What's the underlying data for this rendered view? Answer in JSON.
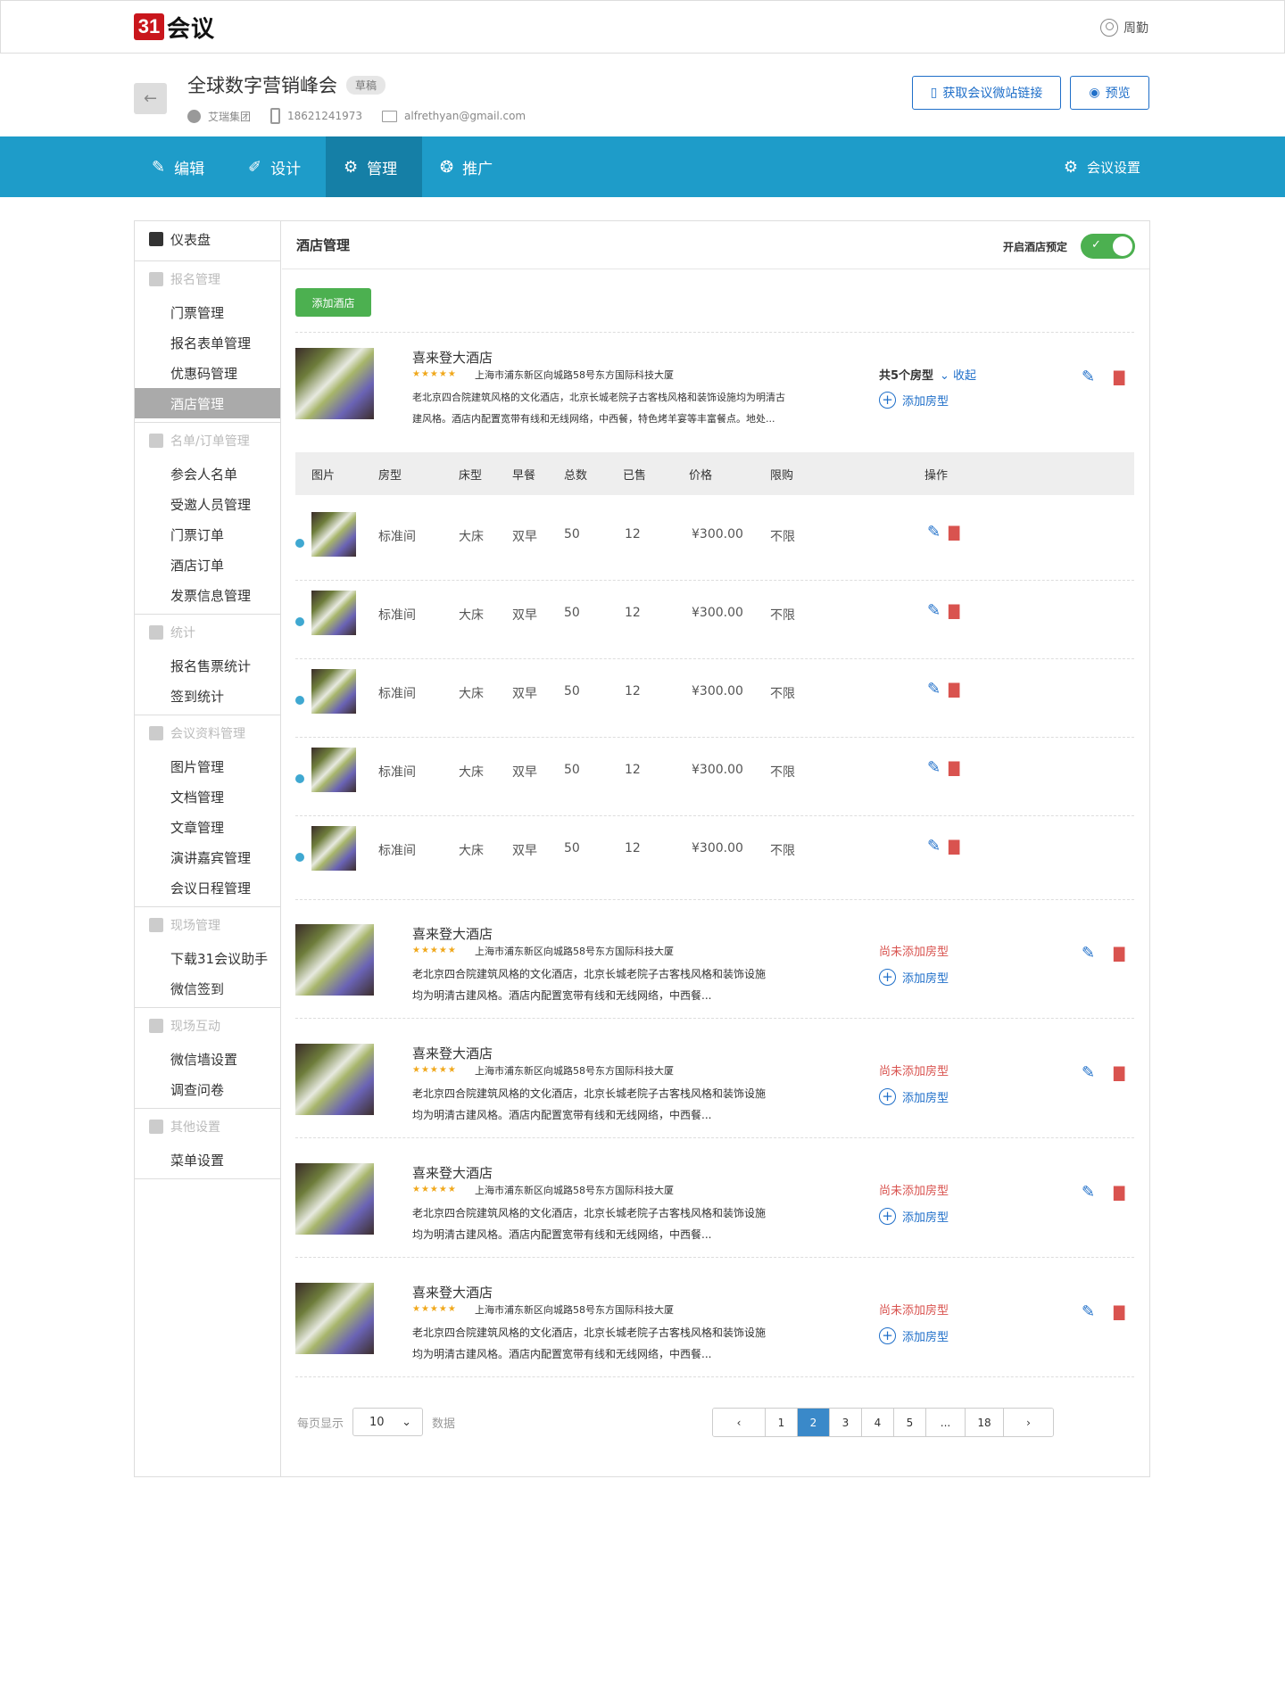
{
  "topbar": {
    "logo_mark": "31",
    "logo_text": "会议",
    "user_name": "周勤"
  },
  "event": {
    "back_icon": "←",
    "title": "全球数字营销峰会",
    "status": "草稿",
    "org": "艾瑞集团",
    "phone": "18621241973",
    "email": "alfrethyan@gmail.com",
    "btn_link": "获取会议微站链接",
    "btn_preview": "预览"
  },
  "nav": {
    "items": [
      {
        "label": "编辑",
        "icon": "✎"
      },
      {
        "label": "设计",
        "icon": "✐"
      },
      {
        "label": "管理",
        "icon": "⚙"
      },
      {
        "label": "推广",
        "icon": "❂"
      }
    ],
    "settings": "会议设置",
    "settings_icon": "⚙"
  },
  "sidebar": {
    "dashboard": "仪表盘",
    "groups": [
      {
        "title": "报名管理",
        "items": [
          "门票管理",
          "报名表单管理",
          "优惠码管理",
          "酒店管理"
        ]
      },
      {
        "title": "名单/订单管理",
        "items": [
          "参会人名单",
          "受邀人员管理",
          "门票订单",
          "酒店订单",
          "发票信息管理"
        ]
      },
      {
        "title": "统计",
        "items": [
          "报名售票统计",
          "签到统计"
        ]
      },
      {
        "title": "会议资料管理",
        "items": [
          "图片管理",
          "文档管理",
          "文章管理",
          "演讲嘉宾管理",
          "会议日程管理"
        ]
      },
      {
        "title": "现场管理",
        "items": [
          "下载31会议助手",
          "微信签到"
        ]
      },
      {
        "title": "现场互动",
        "items": [
          "微信墙设置",
          "调查问卷"
        ]
      },
      {
        "title": "其他设置",
        "items": [
          "菜单设置"
        ]
      }
    ]
  },
  "main": {
    "title": "酒店管理",
    "toggle_label": "开启酒店预定",
    "toggle_on": true,
    "add_hotel": "添加酒店",
    "hotel": {
      "name": "喜来登大酒店",
      "stars": "★★★★★",
      "address": "上海市浦东新区向城路58号东方国际科技大厦",
      "desc_first_1": "老北京四合院建筑风格的文化酒店，北京长城老院子古客栈风格和装饰设施均为明清古",
      "desc_first_2": "建风格。酒店内配置宽带有线和无线网络，中西餐，特色烤羊宴等丰富餐点。地处...",
      "desc_1": "老北京四合院建筑风格的文化酒店，北京长城老院子古客栈风格和装饰设施",
      "desc_2": "均为明清古建风格。酒店内配置宽带有线和无线网络，中西餐...",
      "types_count": "共5个房型",
      "collapse": "收起",
      "add_type": "添加房型",
      "not_added": "尚未添加房型"
    },
    "table": {
      "headers": [
        "图片",
        "房型",
        "床型",
        "早餐",
        "总数",
        "已售",
        "价格",
        "限购",
        "操作"
      ],
      "rows": [
        [
          "标准间",
          "大床",
          "双早",
          "50",
          "12",
          "¥300.00",
          "不限"
        ],
        [
          "标准间",
          "大床",
          "双早",
          "50",
          "12",
          "¥300.00",
          "不限"
        ],
        [
          "标准间",
          "大床",
          "双早",
          "50",
          "12",
          "¥300.00",
          "不限"
        ],
        [
          "标准间",
          "大床",
          "双早",
          "50",
          "12",
          "¥300.00",
          "不限"
        ],
        [
          "标准间",
          "大床",
          "双早",
          "50",
          "12",
          "¥300.00",
          "不限"
        ]
      ]
    },
    "pagination": {
      "per_page_label": "每页显示",
      "per_page": "10",
      "suffix": "数据",
      "pages": [
        "‹",
        "1",
        "2",
        "3",
        "4",
        "5",
        "...",
        "18",
        "›"
      ],
      "active": "2"
    }
  },
  "colors": {
    "nav": "#1e9cc9",
    "nav_active": "#157fa6",
    "green": "#4cb050",
    "blue": "#1f6fc9",
    "red": "#d9534f",
    "star": "#f0a81c"
  }
}
